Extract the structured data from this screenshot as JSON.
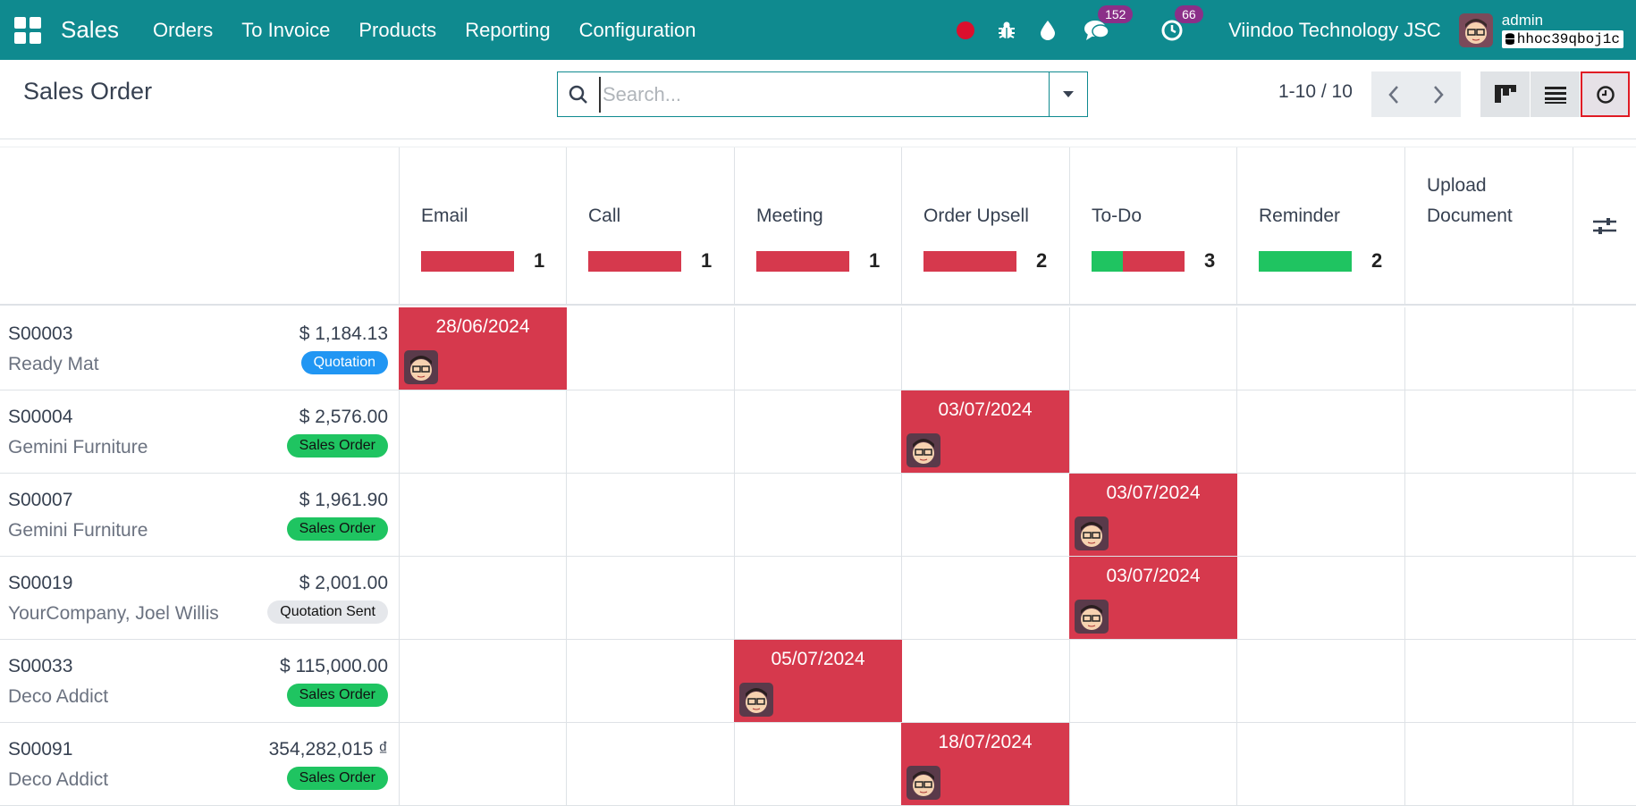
{
  "navbar": {
    "brand": "Sales",
    "menu": [
      "Orders",
      "To Invoice",
      "Products",
      "Reporting",
      "Configuration"
    ],
    "messages_count": "152",
    "activities_count": "66",
    "company": "Viindoo Technology JSC",
    "user": "admin",
    "database": "hhoc39qboj1c"
  },
  "control": {
    "title": "Sales Order",
    "search_placeholder": "Search...",
    "pager": "1-10 / 10"
  },
  "activity_types": [
    {
      "label": "Email",
      "count": "1",
      "segments": [
        {
          "color": "#d6394d",
          "fraction": 1.0
        }
      ]
    },
    {
      "label": "Call",
      "count": "1",
      "segments": [
        {
          "color": "#d6394d",
          "fraction": 1.0
        }
      ]
    },
    {
      "label": "Meeting",
      "count": "1",
      "segments": [
        {
          "color": "#d6394d",
          "fraction": 1.0
        }
      ]
    },
    {
      "label": "Order Upsell",
      "count": "2",
      "segments": [
        {
          "color": "#d6394d",
          "fraction": 1.0
        }
      ]
    },
    {
      "label": "To-Do",
      "count": "3",
      "segments": [
        {
          "color": "#1fc461",
          "fraction": 0.333
        },
        {
          "color": "#d6394d",
          "fraction": 0.667
        }
      ]
    },
    {
      "label": "Reminder",
      "count": "2",
      "segments": [
        {
          "color": "#1fc461",
          "fraction": 1.0
        }
      ]
    },
    {
      "label": "Upload\nDocument",
      "count": "",
      "segments": []
    }
  ],
  "records": [
    {
      "name": "S00003",
      "partner": "Ready Mat",
      "amount": "$ 1,184.13",
      "status": "Quotation",
      "status_kind": "quotation",
      "activity_col": 0,
      "date": "28/06/2024"
    },
    {
      "name": "S00004",
      "partner": "Gemini Furniture",
      "amount": "$ 2,576.00",
      "status": "Sales Order",
      "status_kind": "sale",
      "activity_col": 3,
      "date": "03/07/2024"
    },
    {
      "name": "S00007",
      "partner": "Gemini Furniture",
      "amount": "$ 1,961.90",
      "status": "Sales Order",
      "status_kind": "sale",
      "activity_col": 4,
      "date": "03/07/2024"
    },
    {
      "name": "S00019",
      "partner": "YourCompany, Joel Willis",
      "amount": "$ 2,001.00",
      "status": "Quotation Sent",
      "status_kind": "sent",
      "activity_col": 4,
      "date": "03/07/2024"
    },
    {
      "name": "S00033",
      "partner": "Deco Addict",
      "amount": "$ 115,000.00",
      "status": "Sales Order",
      "status_kind": "sale",
      "activity_col": 2,
      "date": "05/07/2024"
    },
    {
      "name": "S00091",
      "partner": "Deco Addict",
      "amount": "354,282,015 ₫",
      "status": "Sales Order",
      "status_kind": "sale",
      "activity_col": 3,
      "date": "18/07/2024"
    }
  ],
  "status_colors": {
    "quotation": {
      "bg": "#2196f3",
      "fg": "#ffffff"
    },
    "sale": {
      "bg": "#1fc461",
      "fg": "#111111"
    },
    "sent": {
      "bg": "#e5e7eb",
      "fg": "#111111"
    }
  }
}
